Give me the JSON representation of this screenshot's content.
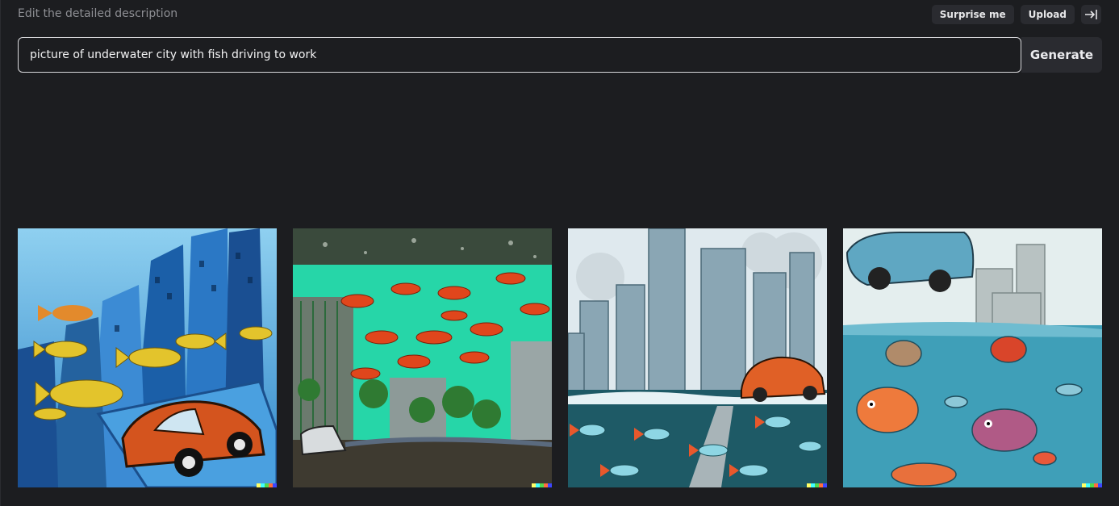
{
  "header": {
    "hint": "Edit the detailed description",
    "surprise_label": "Surprise me",
    "upload_label": "Upload"
  },
  "prompt": {
    "value": "picture of underwater city with fish driving to work"
  },
  "generate_label": "Generate",
  "images": [
    {
      "icon": "generated-image-1"
    },
    {
      "icon": "generated-image-2"
    },
    {
      "icon": "generated-image-3"
    },
    {
      "icon": "generated-image-4"
    }
  ],
  "signature_colors": [
    "#ffff66",
    "#42ffff",
    "#51da4c",
    "#ff6e3c",
    "#3c46ff"
  ]
}
